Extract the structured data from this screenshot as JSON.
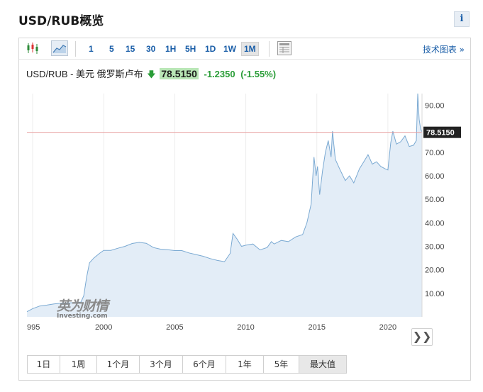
{
  "page": {
    "title": "USD/RUB概览",
    "info_icon": "i"
  },
  "toolbar": {
    "intervals": [
      "1",
      "5",
      "15",
      "30",
      "1H",
      "5H",
      "1D",
      "1W",
      "1M"
    ],
    "active_interval": "1M",
    "tech_chart_link": "技术图表 »"
  },
  "quote": {
    "pair_label": "USD/RUB - 美元 俄罗斯卢布",
    "price": "78.5150",
    "change": "-1.2350",
    "change_pct": "(-1.55%)",
    "direction": "down",
    "up_color": "#2a9d38"
  },
  "logo": {
    "cn": "英为财情",
    "en": "Investing.com"
  },
  "range_buttons": [
    "1日",
    "1周",
    "1个月",
    "3个月",
    "6个月",
    "1年",
    "5年",
    "最大值"
  ],
  "active_range": "最大值",
  "chart_data": {
    "type": "area",
    "title": "",
    "xlabel": "",
    "ylabel": "",
    "x_ticks": [
      "995",
      "2000",
      "2005",
      "2010",
      "2015",
      "2020"
    ],
    "y_ticks": [
      "10.00",
      "20.00",
      "30.00",
      "40.00",
      "50.00",
      "60.00",
      "70.00",
      "90.00"
    ],
    "ylim": [
      0,
      95
    ],
    "xlim": [
      1994.6,
      2022.4
    ],
    "grid": "vertical",
    "last_price_label": "78.5150",
    "last_price": 78.515,
    "line_color": "#7aa9d2",
    "fill_color": "#e3edf7",
    "price_line_color": "#e8a0a0",
    "series": [
      {
        "x": [
          1994.6,
          1995.0,
          1995.5,
          1996.0,
          1996.5,
          1997.0,
          1997.5,
          1998.0,
          1998.4,
          1998.6,
          1998.8,
          1999.0,
          1999.3,
          1999.7,
          2000.0,
          2000.5,
          2001.0,
          2001.5,
          2002.0,
          2002.5,
          2003.0,
          2003.5,
          2004.0,
          2004.5,
          2005.0,
          2005.5,
          2006.0,
          2006.5,
          2007.0,
          2007.5,
          2008.0,
          2008.5,
          2008.9,
          2009.1,
          2009.4,
          2009.7,
          2010.0,
          2010.5,
          2011.0,
          2011.5,
          2011.8,
          2012.0,
          2012.5,
          2013.0,
          2013.5,
          2014.0,
          2014.3,
          2014.6,
          2014.8,
          2014.95,
          2015.05,
          2015.2,
          2015.4,
          2015.6,
          2015.8,
          2016.0,
          2016.1,
          2016.3,
          2016.6,
          2017.0,
          2017.3,
          2017.6,
          2018.0,
          2018.3,
          2018.6,
          2018.9,
          2019.2,
          2019.5,
          2019.8,
          2020.0,
          2020.2,
          2020.35,
          2020.6,
          2020.9,
          2021.2,
          2021.5,
          2021.8,
          2022.0,
          2022.1,
          2022.2,
          2022.3,
          2022.4
        ],
        "y": [
          2.2,
          3.5,
          4.6,
          5.0,
          5.5,
          5.8,
          5.9,
          6.1,
          6.3,
          9.0,
          17.0,
          23.0,
          25.0,
          27.0,
          28.3,
          28.3,
          29.2,
          30.0,
          31.2,
          31.7,
          31.3,
          29.5,
          28.8,
          28.6,
          28.2,
          28.2,
          27.2,
          26.5,
          25.8,
          24.8,
          24.0,
          23.5,
          27.0,
          35.5,
          33.0,
          30.0,
          30.5,
          31.0,
          28.5,
          29.5,
          32.0,
          31.0,
          32.5,
          32.0,
          34.0,
          35.0,
          40.0,
          48.0,
          68.0,
          60.0,
          64.0,
          52.0,
          62.0,
          70.0,
          75.0,
          68.0,
          79.0,
          67.0,
          63.0,
          58.0,
          60.0,
          57.0,
          63.0,
          66.0,
          69.0,
          65.0,
          66.0,
          64.0,
          63.0,
          62.5,
          74.0,
          79.0,
          73.5,
          74.5,
          77.0,
          72.5,
          73.0,
          75.0,
          95.0,
          84.0,
          80.0,
          78.5
        ]
      }
    ]
  }
}
